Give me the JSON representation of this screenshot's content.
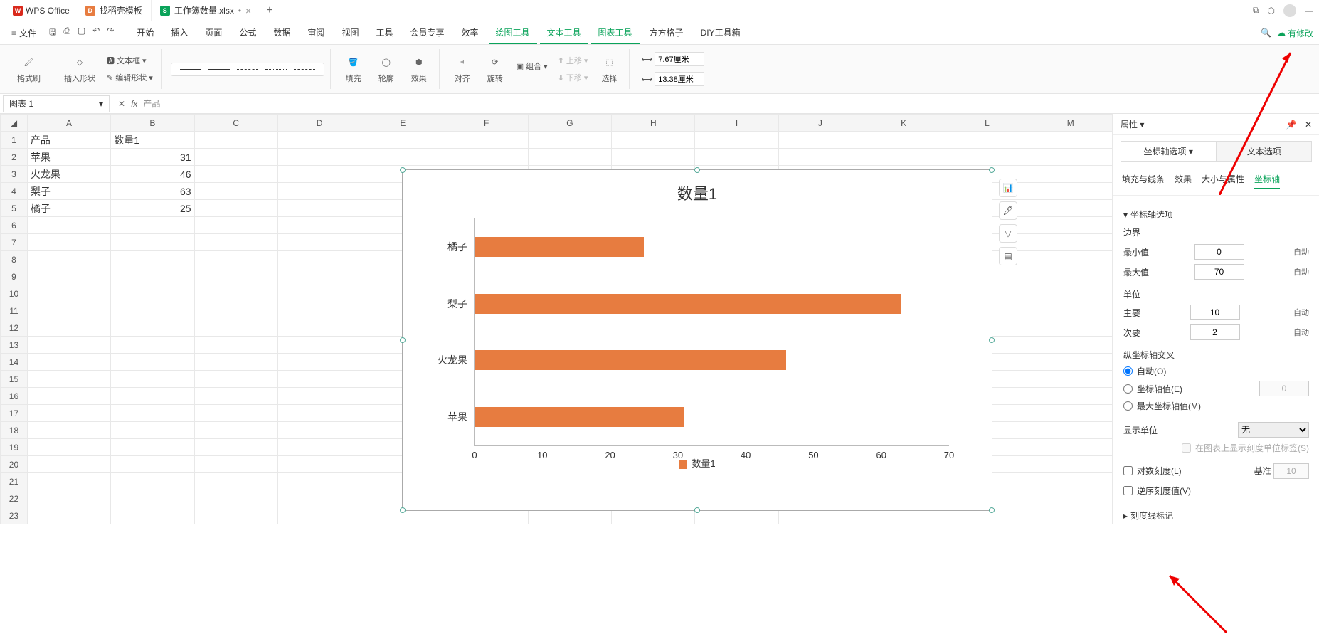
{
  "app": {
    "name": "WPS Office"
  },
  "tabs": [
    {
      "label": "找稻壳模板",
      "icon": "orange"
    },
    {
      "label": "工作簿数量.xlsx",
      "icon": "green",
      "dirty": "•"
    }
  ],
  "menubar": {
    "file": "文件",
    "items": [
      "开始",
      "插入",
      "页面",
      "公式",
      "数据",
      "审阅",
      "视图",
      "工具",
      "会员专享",
      "效率",
      "绘图工具",
      "文本工具",
      "图表工具",
      "方方格子",
      "DIY工具箱"
    ],
    "active_indices": [
      10,
      11,
      12
    ],
    "save_status": "有修改"
  },
  "ribbon": {
    "format_painter": "格式刷",
    "insert_shape": "插入形状",
    "text_box": "文本框",
    "edit_shape": "编辑形状",
    "fill": "填充",
    "outline": "轮廓",
    "effect": "效果",
    "align": "对齐",
    "rotate": "旋转",
    "group": "组合",
    "move_up": "上移",
    "move_down": "下移",
    "select": "选择",
    "width": "7.67厘米",
    "height": "13.38厘米"
  },
  "namebox": "图表 1",
  "formula": "产品",
  "sheet": {
    "headers": [
      "A",
      "B",
      "C",
      "D",
      "E",
      "F",
      "G",
      "H",
      "I",
      "J",
      "K",
      "L",
      "M"
    ],
    "data": [
      [
        "产品",
        "数量1"
      ],
      [
        "苹果",
        "31"
      ],
      [
        "火龙果",
        "46"
      ],
      [
        "梨子",
        "63"
      ],
      [
        "橘子",
        "25"
      ]
    ]
  },
  "chart_data": {
    "type": "bar",
    "title": "数量1",
    "categories": [
      "橘子",
      "梨子",
      "火龙果",
      "苹果"
    ],
    "values": [
      25,
      63,
      46,
      31
    ],
    "xlim": [
      0,
      70
    ],
    "xticks": [
      0,
      10,
      20,
      30,
      40,
      50,
      60,
      70
    ],
    "legend": "数量1"
  },
  "side_panel": {
    "title": "属性",
    "main_tabs": [
      "坐标轴选项",
      "文本选项"
    ],
    "sub_tabs": [
      "填充与线条",
      "效果",
      "大小与属性",
      "坐标轴"
    ],
    "section_axis_options": "坐标轴选项",
    "boundary": "边界",
    "min_label": "最小值",
    "min_value": "0",
    "max_label": "最大值",
    "max_value": "70",
    "auto": "自动",
    "unit": "单位",
    "major_label": "主要",
    "major_value": "10",
    "minor_label": "次要",
    "minor_value": "2",
    "cross": "纵坐标轴交叉",
    "cross_auto": "自动(O)",
    "cross_value": "坐标轴值(E)",
    "cross_value_input": "0",
    "cross_max": "最大坐标轴值(M)",
    "display_unit": "显示单位",
    "display_unit_value": "无",
    "show_unit_label": "在图表上显示刻度单位标签(S)",
    "log_scale": "对数刻度(L)",
    "log_base_label": "基准",
    "log_base": "10",
    "reverse": "逆序刻度值(V)",
    "tick_marks": "刻度线标记"
  }
}
